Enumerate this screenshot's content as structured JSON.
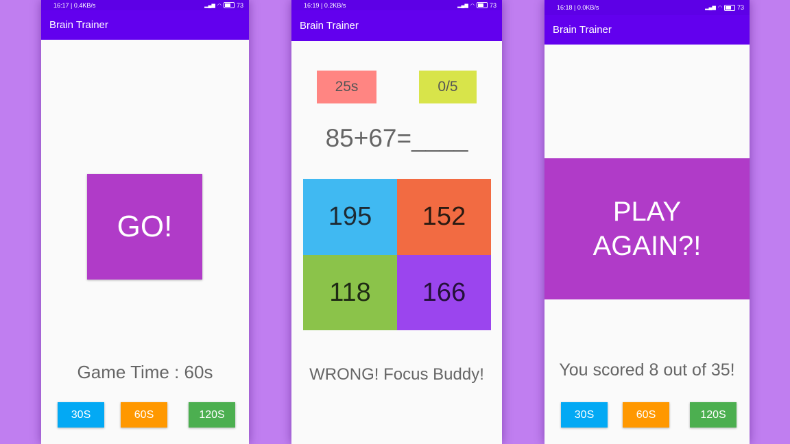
{
  "phone1": {
    "status_time": "16:17 | 0.4KB/s",
    "status_battery": "73",
    "app_title": "Brain Trainer",
    "go_label": "GO!",
    "game_time": "Game Time : 60s",
    "buttons": [
      "30S",
      "60S",
      "120S"
    ]
  },
  "phone2": {
    "status_time": "16:19 | 0.2KB/s",
    "status_battery": "73",
    "app_title": "Brain Trainer",
    "timer": "25s",
    "score": "0/5",
    "question": "85+67=____",
    "answers": [
      "195",
      "152",
      "118",
      "166"
    ],
    "result": "WRONG! Focus Buddy!"
  },
  "phone3": {
    "status_time": "16:18 | 0.0KB/s",
    "status_battery": "73",
    "app_title": "Brain Trainer",
    "play_again_line1": "PLAY",
    "play_again_line2": "AGAIN?!",
    "score_text": "You scored 8 out of 35!",
    "buttons": [
      "30S",
      "60S",
      "120S"
    ]
  },
  "colors": {
    "background": "#c07ef0",
    "app_bar": "#6200ee",
    "go_button": "#b03bc8",
    "timer": "#ff8582",
    "score": "#d8e44a",
    "answer_1": "#40b9f2",
    "answer_2": "#f26b42",
    "answer_3": "#8bc34a",
    "answer_4": "#9b45ee",
    "btn_30": "#03a9f4",
    "btn_60": "#ff9800",
    "btn_120": "#4caf50"
  }
}
